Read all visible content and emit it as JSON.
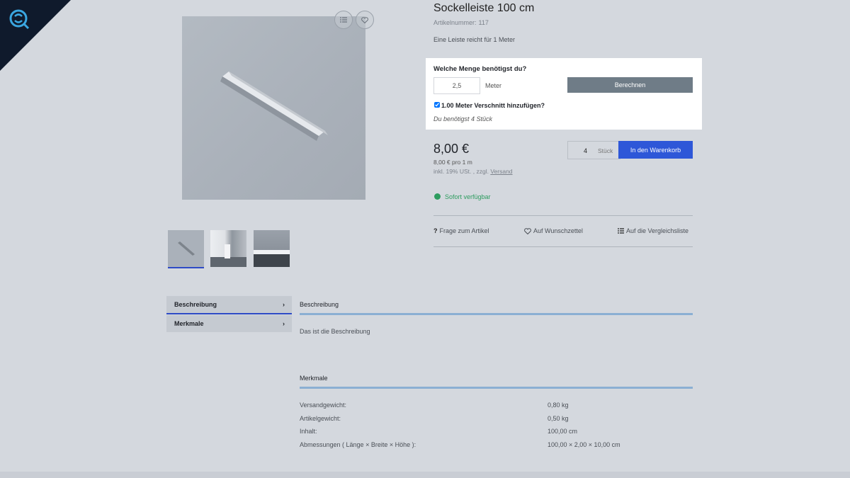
{
  "colors": {
    "background": "#d4d8de",
    "accent_blue": "#2e57d8",
    "calc_button": "#6f7c87",
    "available_green": "#2d9c5f",
    "section_line": "#8bafd3"
  },
  "product": {
    "title": "Sockelleiste 100 cm",
    "article_label": "Artikelnummer:",
    "article_number": "117",
    "short_description": "Eine Leiste reicht für 1 Meter",
    "image_icons": [
      "list-icon",
      "heart-icon"
    ],
    "thumbnails": [
      {
        "name": "thumbnail-1",
        "active": true
      },
      {
        "name": "thumbnail-2",
        "active": false
      },
      {
        "name": "thumbnail-3",
        "active": false
      }
    ]
  },
  "calculator": {
    "question": "Welche Menge benötigst du?",
    "amount_value": "2,5",
    "unit": "Meter",
    "button_label": "Berechnen",
    "waste_checked": true,
    "waste_label": "1.00 Meter Verschnitt hinzufügen?",
    "result": "Du benötigst 4 Stück"
  },
  "pricing": {
    "price": "8,00 €",
    "unit_price": "8,00 € pro 1 m",
    "tax_prefix": "inkl. 19% USt. , zzgl.",
    "tax_link": "Versand",
    "quantity": "4",
    "quantity_unit": "Stück",
    "cart_button": "In den Warenkorb"
  },
  "availability": {
    "text": "Sofort verfügbar"
  },
  "actions": {
    "question": "Frage zum Artikel",
    "wishlist": "Auf Wunschzettel",
    "compare": "Auf die Vergleichsliste"
  },
  "tabs": [
    {
      "label": "Beschreibung",
      "active": true
    },
    {
      "label": "Merkmale",
      "active": false
    }
  ],
  "description": {
    "heading": "Beschreibung",
    "text": "Das ist die Beschreibung"
  },
  "features": {
    "heading": "Merkmale",
    "rows": [
      {
        "label": "Versandgewicht:",
        "value": "0,80 kg"
      },
      {
        "label": "Artikelgewicht:",
        "value": "0,50 kg"
      },
      {
        "label": "Inhalt:",
        "value": "100,00 cm"
      },
      {
        "label": "Abmessungen ( Länge × Breite × Höhe ):",
        "value": "100,00 × 2,00 × 10,00 cm"
      }
    ]
  }
}
